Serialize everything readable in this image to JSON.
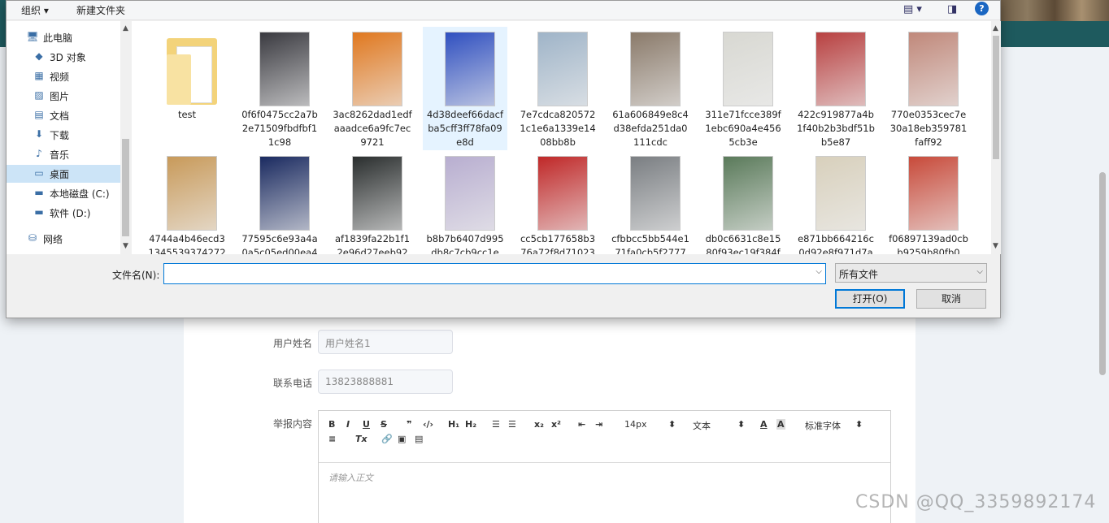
{
  "dialog": {
    "toolbar": {
      "organize": "组织",
      "new_folder": "新建文件夹",
      "help": "?"
    },
    "nav": [
      {
        "label": "此电脑",
        "icon": "computer-icon",
        "glyph": "🖥"
      },
      {
        "label": "3D 对象",
        "icon": "cube-icon",
        "glyph": "◆"
      },
      {
        "label": "视频",
        "icon": "video-icon",
        "glyph": "▦"
      },
      {
        "label": "图片",
        "icon": "picture-icon",
        "glyph": "▨"
      },
      {
        "label": "文档",
        "icon": "document-icon",
        "glyph": "▤"
      },
      {
        "label": "下载",
        "icon": "download-icon",
        "glyph": "⬇"
      },
      {
        "label": "音乐",
        "icon": "music-icon",
        "glyph": "♪"
      },
      {
        "label": "桌面",
        "icon": "desktop-icon",
        "glyph": "▭",
        "selected": true
      },
      {
        "label": "本地磁盘 (C:)",
        "icon": "drive-icon",
        "glyph": "▬"
      },
      {
        "label": "软件 (D:)",
        "icon": "drive-icon",
        "glyph": "▬"
      },
      {
        "label": "网络",
        "icon": "network-icon",
        "glyph": "⛁"
      }
    ],
    "files_row1": [
      {
        "name": "test",
        "folder": true
      },
      {
        "name": "0f6f0475cc2a7b2e71509fbdfbf11c98",
        "color": "#3a3a40"
      },
      {
        "name": "3ac8262dad1edfaaadce6a9fc7ec9721",
        "color": "#e0781f"
      },
      {
        "name": "4d38deef66dacfba5cff3ff78fa09e8d",
        "color": "#3050c0",
        "selected": true
      },
      {
        "name": "7e7cdca8205721c1e6a1339e1408bb8b",
        "color": "#9fb4c8"
      },
      {
        "name": "61a606849e8c4d38efda251da0111cdc",
        "color": "#8a7a6a"
      },
      {
        "name": "311e71fcce389f1ebc690a4e4565cb3e",
        "color": "#d8d8d2"
      },
      {
        "name": "422c919877a4b1f40b2b3bdf51bb5e87",
        "color": "#b84040"
      },
      {
        "name": "770e0353cec7e30a18eb359781faff92",
        "color": "#c0887a"
      }
    ],
    "files_row2": [
      {
        "name": "4744a4b46ecd31345539374272",
        "color": "#c89a5a"
      },
      {
        "name": "77595c6e93a4a0a5c05ed00ea4",
        "color": "#1a2a60"
      },
      {
        "name": "af1839fa22b1f12e96d27eeb92",
        "color": "#2a2e2e"
      },
      {
        "name": "b8b7b6407d995db8c7cb9cc1e",
        "color": "#b8aed0"
      },
      {
        "name": "cc5cb177658b376a72f8d71023",
        "color": "#c02828"
      },
      {
        "name": "cfbbcc5bb544e171fa0cb5f2777",
        "color": "#7a7e82"
      },
      {
        "name": "db0c6631c8e1580f93ec19f384f",
        "color": "#5a7a5a"
      },
      {
        "name": "e871bb664216c0d92e8f971d7a",
        "color": "#d8d0bc"
      },
      {
        "name": "f06897139ad0cbb9259b80fb0",
        "color": "#c84a3a"
      }
    ],
    "filename_label": "文件名(N):",
    "filename_value": "",
    "filetype": "所有文件",
    "open_button": "打开(O)",
    "cancel_button": "取消"
  },
  "form": {
    "username_label": "用户姓名",
    "username_value": "用户姓名1",
    "phone_label": "联系电话",
    "phone_value": "13823888881",
    "content_label": "举报内容",
    "editor": {
      "font_size": "14px",
      "block_type": "文本",
      "font_family": "标准字体",
      "placeholder": "请输入正文"
    }
  },
  "watermark": "CSDN @QQ_3359892174"
}
